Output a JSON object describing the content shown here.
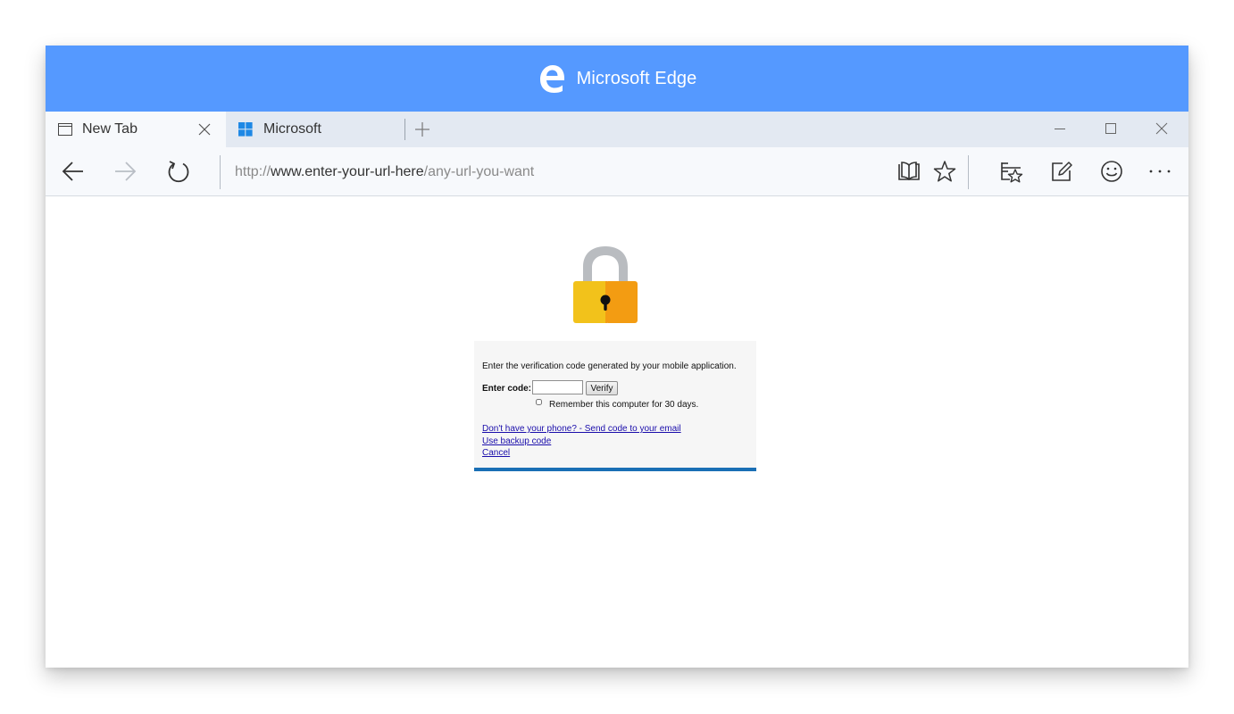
{
  "window": {
    "title": "Microsoft Edge"
  },
  "tabs": [
    {
      "label": "New Tab",
      "icon": "blank-page-icon",
      "active": true
    },
    {
      "label": "Microsoft",
      "icon": "windows-logo-icon",
      "active": false
    }
  ],
  "address_bar": {
    "protocol": "http://",
    "host": "www.enter-your-url-here",
    "path": "/any-url-you-want"
  },
  "toolbar_icons": [
    "back-arrow-icon",
    "forward-arrow-icon",
    "refresh-icon",
    "reading-view-icon",
    "favorite-star-icon",
    "favorites-hub-icon",
    "web-note-icon",
    "feedback-smiley-icon",
    "more-dots-icon"
  ],
  "verification": {
    "prompt": "Enter the verification code generated by your mobile application.",
    "code_label": "Enter code:",
    "code_value": "",
    "verify_button": "Verify",
    "remember_label": "Remember this computer for 30 days.",
    "remember_checked": false,
    "links": [
      "Don't have your phone? - Send code to your email",
      "Use backup code",
      "Cancel"
    ]
  },
  "colors": {
    "title_bar": "#5599ff",
    "tab_bar": "#e3e9f2",
    "accent_bar": "#1a6fb5",
    "link": "#1a0dab",
    "lock_body_left": "#f2c21b",
    "lock_body_right": "#f39c12",
    "lock_shackle": "#b9bcc0"
  }
}
